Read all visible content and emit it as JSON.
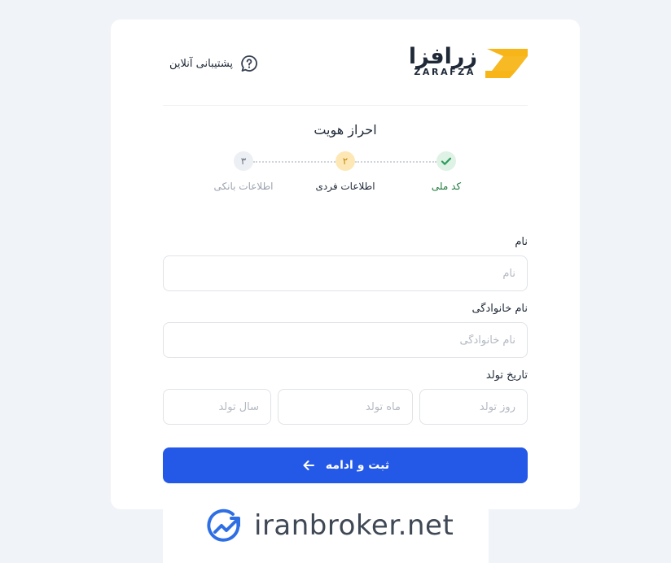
{
  "brand": {
    "logo_fa": "زرافزا",
    "logo_en": "ZARAFZA"
  },
  "header": {
    "support_label": "پشتیبانی آنلاین",
    "support_icon": "question-bubble-icon"
  },
  "page_title": "احراز هویت",
  "steps": [
    {
      "number": "",
      "label": "کد ملی",
      "status": "completed",
      "icon": "check-icon"
    },
    {
      "number": "۲",
      "label": "اطلاعات فردی",
      "status": "active"
    },
    {
      "number": "۳",
      "label": "اطلاعات بانکی",
      "status": "pending"
    }
  ],
  "form": {
    "first_name": {
      "label": "نام",
      "placeholder": "نام",
      "value": ""
    },
    "last_name": {
      "label": "نام خانوادگی",
      "placeholder": "نام خانوادگی",
      "value": ""
    },
    "birth_date": {
      "label": "تاریخ تولد",
      "day_placeholder": "روز تولد",
      "month_placeholder": "ماه تولد",
      "year_placeholder": "سال تولد"
    }
  },
  "submit_label": "ثبت و ادامه",
  "watermark": {
    "text": "iranbroker.net"
  },
  "colors": {
    "primary": "#2459e8",
    "brand_accent": "#f7b518",
    "success": "#2e9e5b",
    "warning": "#fde8b5",
    "background": "#f0f3f7"
  }
}
